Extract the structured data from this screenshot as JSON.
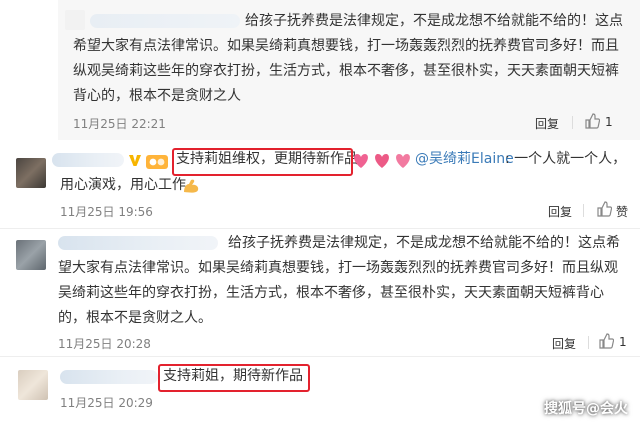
{
  "comments": [
    {
      "text": "给孩子抚养费是法律规定，不是成龙想不给就能不给的！这点希望大家有点法律常识。如果吴绮莉真想要钱，打一场轰轰烈烈的抚养费官司多好！而且纵观吴绮莉这些年的穿衣打扮，生活方式，根本不奢侈，甚至很朴实，天天素面朝天短裤背心的，根本不是贪财之人",
      "time": "11月25日 22:21",
      "reply": "回复",
      "likes": "1"
    },
    {
      "highlight": "支持莉姐维权，更期待新作品",
      "mention": "@吴绮莉Elaine",
      "text_after_mention": ": 一个人就一个人，",
      "text_line2": "用心演戏，用心工作",
      "time": "11月25日 19:56",
      "reply": "回复",
      "likes": "赞"
    },
    {
      "text": "给孩子抚养费是法律规定，不是成龙想不给就能不给的！这点希望大家有点法律常识。如果吴绮莉真想要钱，打一场轰轰烈烈的抚养费官司多好！而且纵观吴绮莉这些年的穿衣打扮，生活方式，根本不奢侈，甚至很朴实，天天素面朝天短裤背心的，根本不是贪财之人。",
      "time": "11月25日 20:28",
      "reply": "回复",
      "likes": "1"
    },
    {
      "highlight": "支持莉姐，期待新作品",
      "time": "11月25日 20:29"
    }
  ],
  "watermark": "搜狐号@会火",
  "colors": {
    "highlight_box": "#e3222e",
    "mention": "#3b7bb8",
    "meta": "#808080"
  }
}
